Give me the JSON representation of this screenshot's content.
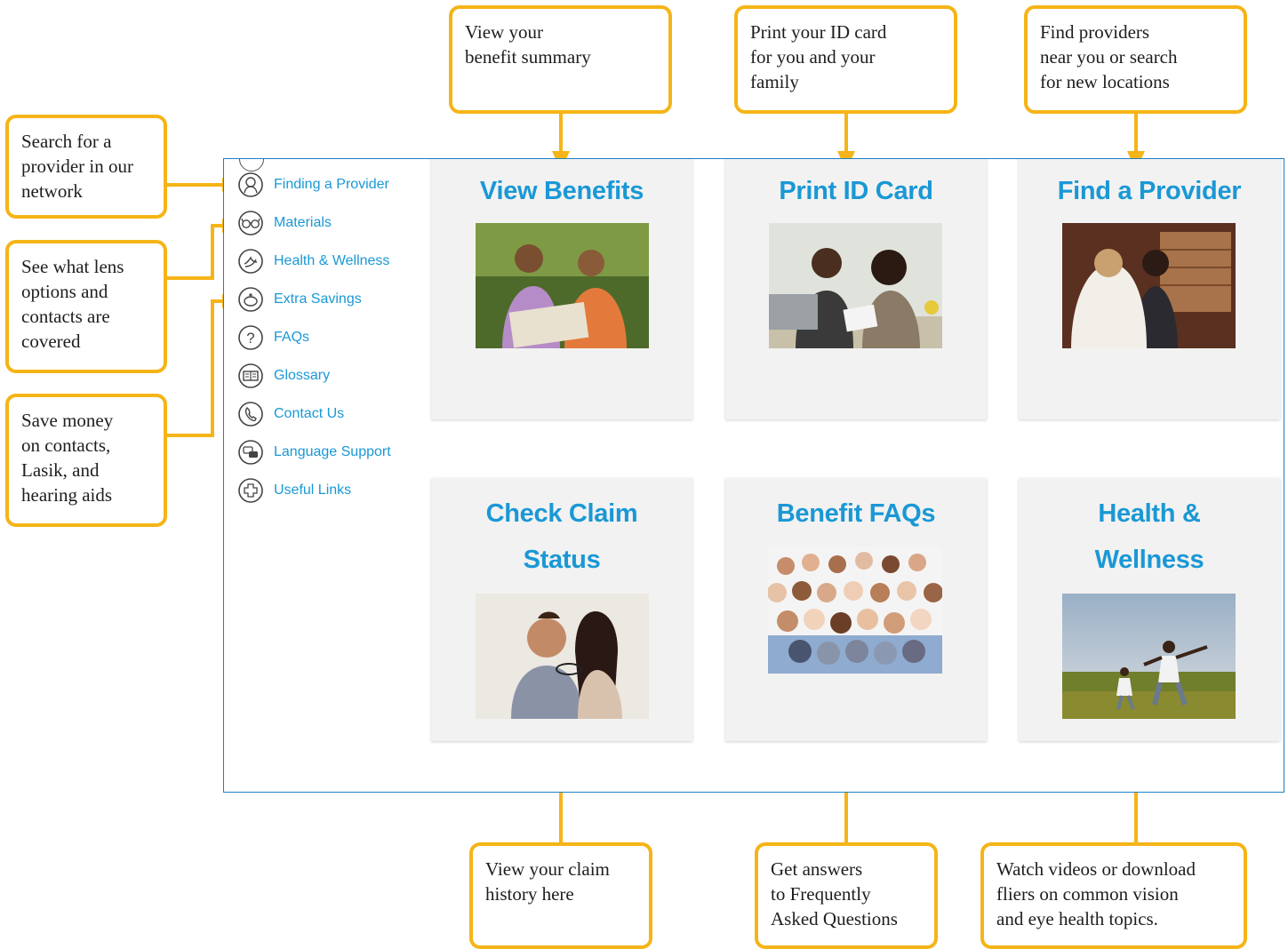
{
  "accent_color": "#f5b417",
  "link_color": "#1a98d5",
  "frame_border_color": "#1f7fc4",
  "sidebar": {
    "items": [
      {
        "label": "Finding a Provider",
        "icon": "provider-icon"
      },
      {
        "label": "Materials",
        "icon": "eyeglasses-icon"
      },
      {
        "label": "Health & Wellness",
        "icon": "health-wellness-icon"
      },
      {
        "label": "Extra Savings",
        "icon": "piggy-bank-icon"
      },
      {
        "label": "FAQs",
        "icon": "question-icon"
      },
      {
        "label": "Glossary",
        "icon": "book-icon"
      },
      {
        "label": "Contact Us",
        "icon": "phone-icon"
      },
      {
        "label": "Language Support",
        "icon": "language-icon"
      },
      {
        "label": "Useful Links",
        "icon": "plus-icon"
      }
    ]
  },
  "tiles": [
    {
      "title_lines": [
        "View Benefits"
      ],
      "image": "couple-hikers-photo"
    },
    {
      "title_lines": [
        "Print ID Card"
      ],
      "image": "women-talking-photo"
    },
    {
      "title_lines": [
        "Find a Provider"
      ],
      "image": "eye-exam-photo"
    },
    {
      "title_lines": [
        "Check Claim",
        "Status"
      ],
      "image": "couple-eyeglasses-photo"
    },
    {
      "title_lines": [
        "Benefit FAQs"
      ],
      "image": "crowd-photo"
    },
    {
      "title_lines": [
        "Health &",
        "Wellness"
      ],
      "image": "father-child-field-photo"
    }
  ],
  "callouts": {
    "view_benefits": "View your\nbenefit summary",
    "print_id": "Print your ID card\nfor you and your\nfamily",
    "find_provider": "Find providers\nnear you or search\nfor new locations",
    "search_provider": "Search for a\nprovider in our\nnetwork",
    "materials": "See what lens\noptions and\ncontacts are\ncovered",
    "savings": "Save money\non contacts,\nLasik, and\nhearing aids",
    "claim": "View your claim\nhistory here",
    "faqs": "Get answers\nto Frequently\nAsked Questions",
    "wellness": "Watch videos or download\nfliers on common vision\nand eye health topics."
  }
}
